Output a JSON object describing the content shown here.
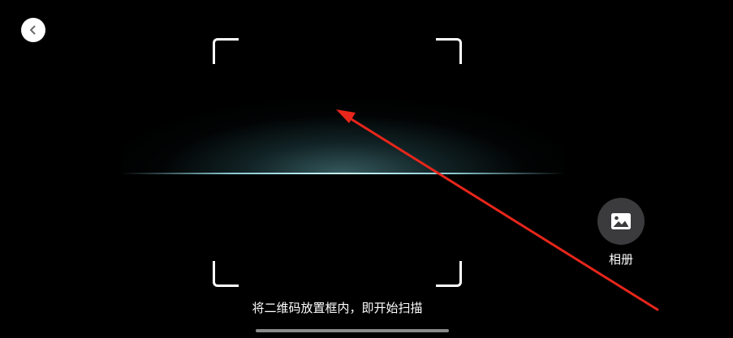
{
  "header": {
    "back_icon": "chevron-left-icon"
  },
  "scanner": {
    "hint": "将二维码放置框内，即开始扫描",
    "glow_color": "#8ad8e0"
  },
  "album": {
    "icon": "image-icon",
    "label": "相册"
  },
  "annotation": {
    "color": "#e8261b"
  }
}
